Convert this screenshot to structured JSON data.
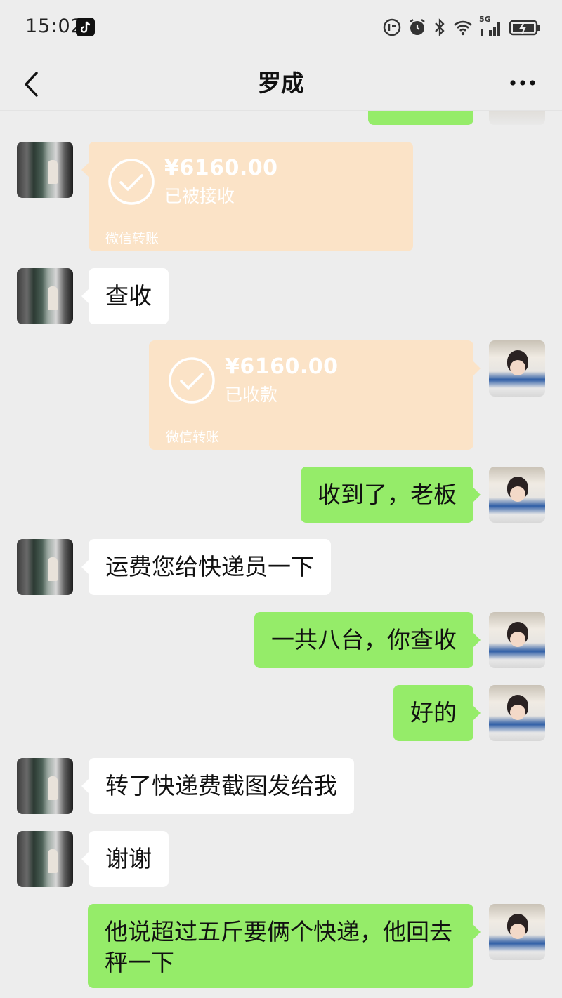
{
  "status_bar": {
    "time": "15:02",
    "network": "5G",
    "icons": [
      "tiktok-icon",
      "data-saver-icon",
      "alarm-icon",
      "bluetooth-icon",
      "wifi-icon",
      "signal-icon",
      "battery-icon"
    ]
  },
  "header": {
    "title": "罗成",
    "back_icon": "chevron-left-icon",
    "more_icon": "more-horizontal-icon"
  },
  "colors": {
    "background": "#ededed",
    "sent_bubble": "#95ec69",
    "received_bubble": "#ffffff",
    "transfer_card": "#fbe3c7"
  },
  "messages": [
    {
      "side": "left",
      "type": "transfer",
      "amount": "¥6160.00",
      "status": "已被接收",
      "brand": "微信转账"
    },
    {
      "side": "left",
      "type": "text",
      "text": "查收"
    },
    {
      "side": "right",
      "type": "transfer",
      "amount": "¥6160.00",
      "status": "已收款",
      "brand": "微信转账"
    },
    {
      "side": "right",
      "type": "text",
      "text": "收到了，老板"
    },
    {
      "side": "left",
      "type": "text",
      "text": "运费您给快递员一下"
    },
    {
      "side": "right",
      "type": "text",
      "text": "一共八台，你查收"
    },
    {
      "side": "right",
      "type": "text",
      "text": "好的"
    },
    {
      "side": "left",
      "type": "text",
      "text": "转了快递费截图发给我"
    },
    {
      "side": "left",
      "type": "text",
      "text": "谢谢"
    },
    {
      "side": "right",
      "type": "text",
      "text": "他说超过五斤要俩个快递，他回去秤一下"
    }
  ]
}
